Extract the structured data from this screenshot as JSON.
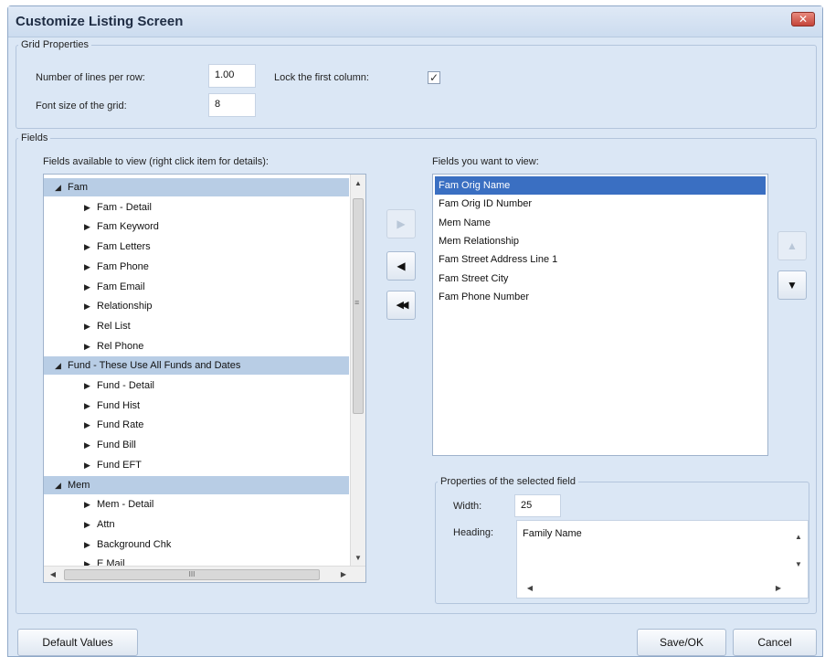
{
  "window": {
    "title": "Customize Listing Screen",
    "close_glyph": "✕"
  },
  "grid_properties": {
    "legend": "Grid Properties",
    "lines_per_row_label": "Number of lines per row:",
    "lines_per_row_value": "1.00",
    "lock_first_column_label": "Lock the first column:",
    "lock_first_column_checked": true,
    "font_size_label": "Font size of the grid:",
    "font_size_value": "8"
  },
  "fields": {
    "legend": "Fields",
    "available_label": "Fields available to view (right click item for details):",
    "wanted_label": "Fields you want to view:",
    "available_tree": [
      {
        "label": "Fam",
        "group": true
      },
      {
        "label": "Fam - Detail",
        "group": false
      },
      {
        "label": "Fam Keyword",
        "group": false
      },
      {
        "label": "Fam Letters",
        "group": false
      },
      {
        "label": "Fam Phone",
        "group": false
      },
      {
        "label": "Fam Email",
        "group": false
      },
      {
        "label": "Relationship",
        "group": false
      },
      {
        "label": "Rel List",
        "group": false
      },
      {
        "label": "Rel Phone",
        "group": false
      },
      {
        "label": "Fund - These Use All Funds and Dates",
        "group": true
      },
      {
        "label": "Fund - Detail",
        "group": false
      },
      {
        "label": "Fund Hist",
        "group": false
      },
      {
        "label": "Fund Rate",
        "group": false
      },
      {
        "label": "Fund Bill",
        "group": false
      },
      {
        "label": "Fund EFT",
        "group": false
      },
      {
        "label": "Mem",
        "group": true
      },
      {
        "label": "Mem - Detail",
        "group": false
      },
      {
        "label": "Attn",
        "group": false
      },
      {
        "label": "Background Chk",
        "group": false
      },
      {
        "label": "E Mail",
        "group": false
      }
    ],
    "wanted_list": [
      "Fam Orig Name",
      "Fam Orig ID Number",
      "Mem Name",
      "Mem Relationship",
      "Fam Street Address Line 1",
      "Fam Street City",
      "Fam Phone Number"
    ],
    "selected_index": 0
  },
  "selected_field_properties": {
    "legend": "Properties of the selected field",
    "width_label": "Width:",
    "width_value": "25",
    "heading_label": "Heading:",
    "heading_value": "Family Name"
  },
  "buttons": {
    "default_values": "Default Values",
    "save_ok": "Save/OK",
    "cancel": "Cancel",
    "add_glyph": "▶",
    "remove_glyph": "◀",
    "remove_all_glyph": "◀◀",
    "move_up_glyph": "▲",
    "move_down_glyph": "▼"
  },
  "icons": {
    "expanded": "◢",
    "collapsed": "▶",
    "scroll_up": "▲",
    "scroll_down": "▼",
    "scroll_left": "◀",
    "scroll_right": "▶",
    "thumb_grip_v": "≡",
    "thumb_grip_h": "III"
  }
}
